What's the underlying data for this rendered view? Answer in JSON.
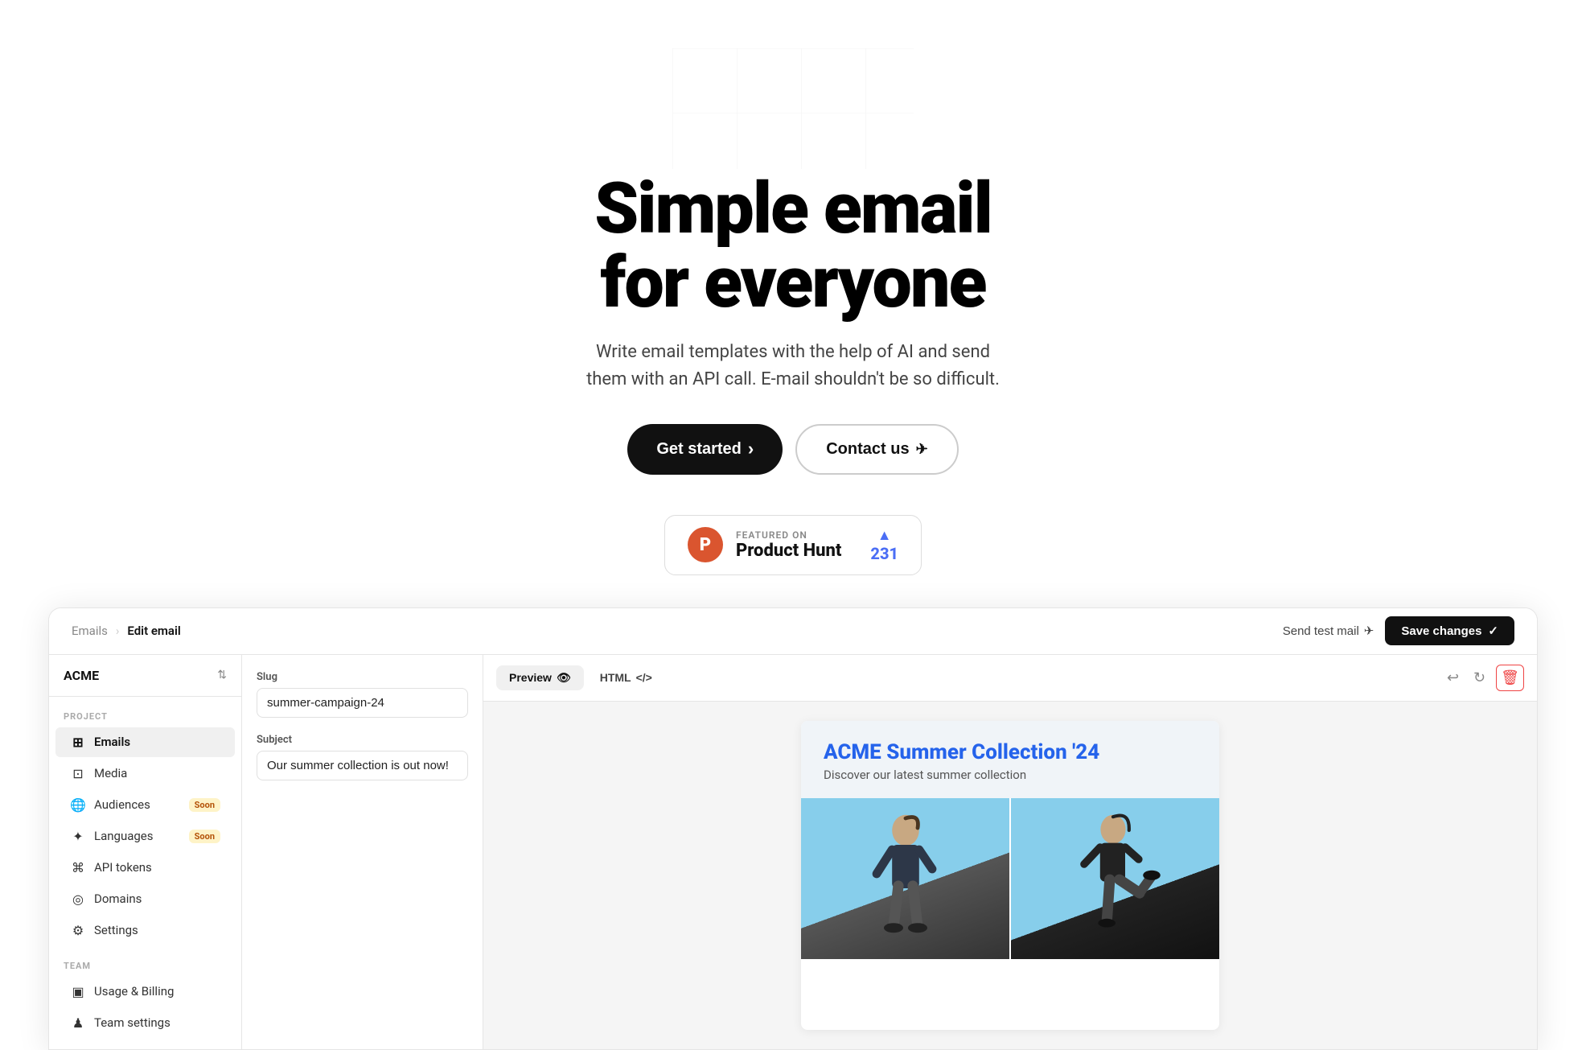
{
  "hero": {
    "title_line1": "Simple email",
    "title_line2": "for everyone",
    "subtitle": "Write email templates with the help of AI and send them with an API call. E-mail shouldn't be so difficult.",
    "btn_start": "Get started",
    "btn_contact": "Contact us"
  },
  "product_hunt": {
    "featured_label": "FEATURED ON",
    "product_name": "Product Hunt",
    "votes": "231"
  },
  "app": {
    "workspace": "ACME",
    "breadcrumb_parent": "Emails",
    "breadcrumb_current": "Edit email",
    "send_test_label": "Send test mail",
    "save_label": "Save changes",
    "sidebar": {
      "project_label": "PROJECT",
      "team_label": "TEAM",
      "items": [
        {
          "label": "Emails",
          "icon": "⊞",
          "active": true
        },
        {
          "label": "Media",
          "icon": "⊡",
          "active": false
        },
        {
          "label": "Audiences",
          "icon": "⊕",
          "active": false,
          "badge": "Soon"
        },
        {
          "label": "Languages",
          "icon": "✦",
          "active": false,
          "badge": "Soon"
        },
        {
          "label": "API tokens",
          "icon": "⌘",
          "active": false
        },
        {
          "label": "Domains",
          "icon": "◎",
          "active": false
        },
        {
          "label": "Settings",
          "icon": "⚙",
          "active": false
        }
      ],
      "team_items": [
        {
          "label": "Usage & Billing",
          "icon": "▣",
          "active": false
        },
        {
          "label": "Team settings",
          "icon": "♟",
          "active": false
        }
      ]
    },
    "slug_label": "Slug",
    "slug_value": "summer-campaign-24",
    "subject_label": "Subject",
    "subject_value": "Our summer collection is out now!",
    "preview_tab": "Preview",
    "html_tab": "HTML",
    "email": {
      "title": "ACME Summer Collection '24",
      "subtitle": "Discover our latest summer collection"
    }
  }
}
